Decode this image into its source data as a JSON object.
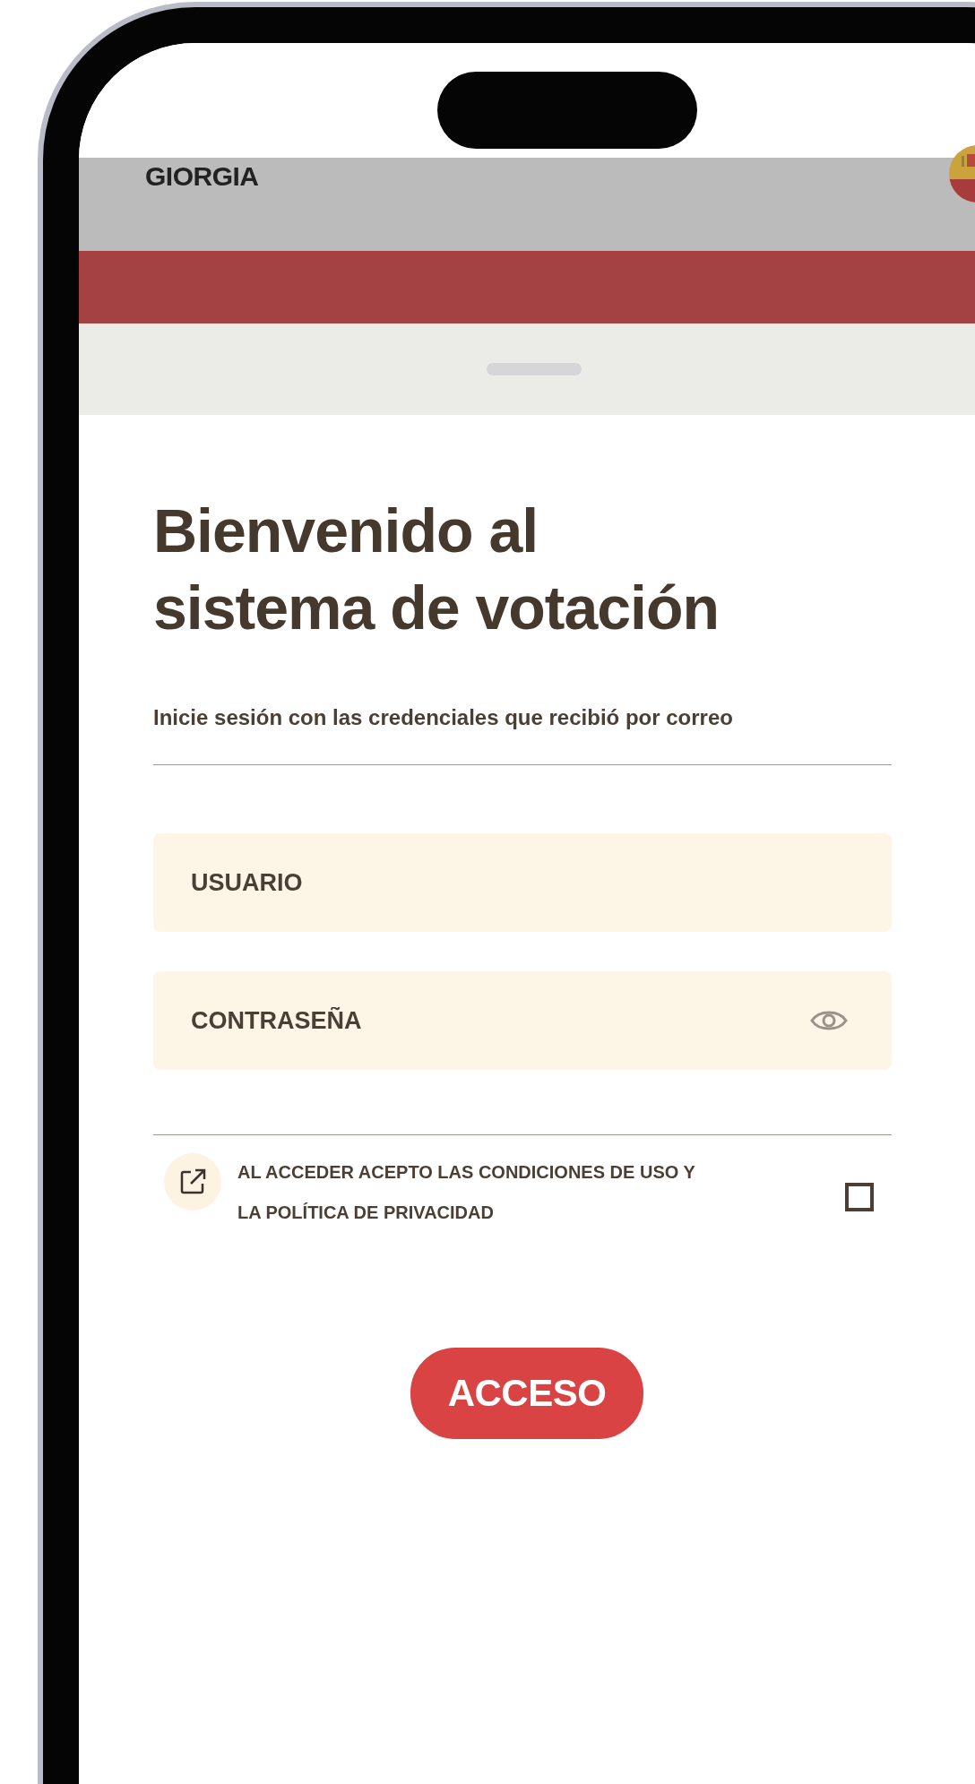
{
  "header": {
    "brand": "GIORGIA"
  },
  "login": {
    "title": "Bienvenido al sistema de votación",
    "subtitle": "Inicie sesión con las credenciales que recibió por correo",
    "fields": [
      {
        "kind": "text",
        "placeholder": "USUARIO"
      },
      {
        "kind": "password",
        "placeholder": "CONTRASEÑA"
      }
    ],
    "consent": {
      "text": "AL ACCEDER ACEPTO LAS CONDICIONES DE USO Y LA POLÍTICA DE PRIVACIDAD",
      "checked": false
    },
    "button": "ACCESO"
  }
}
